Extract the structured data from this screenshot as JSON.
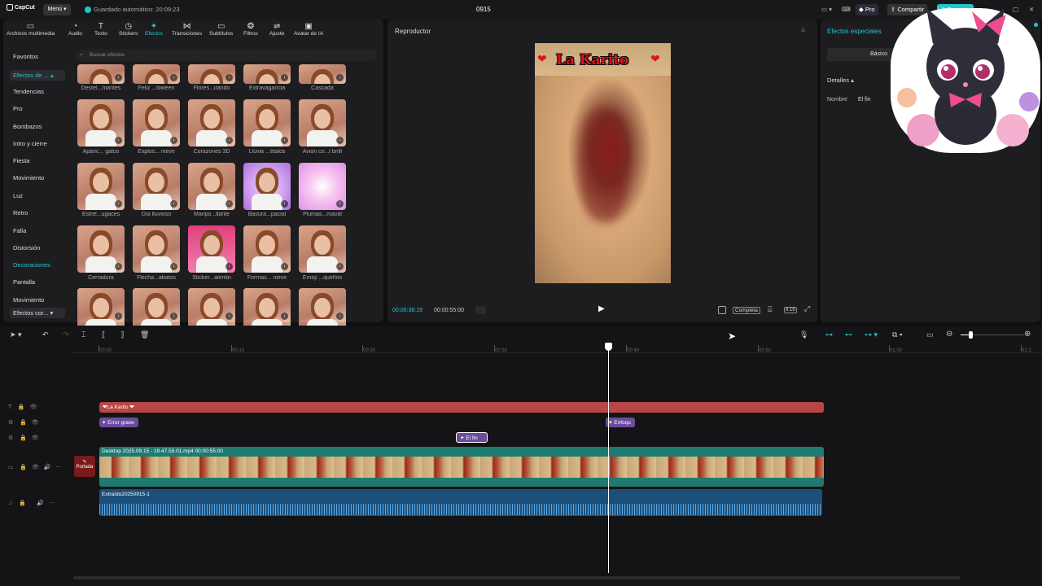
{
  "app": {
    "logo": "CapCut",
    "menu": "Menú",
    "autosave": "Guardado automático: 20:09:23",
    "project_title": "0915",
    "pro": "Pro",
    "share": "Compartir",
    "export": "Exportar"
  },
  "toolbar": [
    {
      "label": "Archivos multimedia",
      "icon": "▭"
    },
    {
      "label": "Audio",
      "icon": "◔"
    },
    {
      "label": "Texto",
      "icon": "T"
    },
    {
      "label": "Stickers",
      "icon": "◷"
    },
    {
      "label": "Efectos",
      "icon": "✦"
    },
    {
      "label": "Transiciones",
      "icon": "⋈"
    },
    {
      "label": "Subtítulos",
      "icon": "▭"
    },
    {
      "label": "Filtros",
      "icon": "❂"
    },
    {
      "label": "Ajuste",
      "icon": "⇌"
    },
    {
      "label": "Avatar de IA",
      "icon": "▣"
    }
  ],
  "categories": [
    "Favoritos",
    "Efectos de ...",
    "Tendencias",
    "Pro",
    "Bombazos",
    "Intro y cierre",
    "Fiesta",
    "Movimiento",
    "Luz",
    "Retro",
    "Falla",
    "Distorsión",
    "Decoraciones",
    "Pantalla",
    "Movimiento",
    "Efectos cor..."
  ],
  "search_placeholder": "Buscar efectos",
  "effects": [
    [
      "Destel...mantes",
      "Feliz ...loween",
      "Flores...irando",
      "Extravagancia",
      "Cascada"
    ],
    [
      "Aparic... gatos",
      "Explos... nieve",
      "Corazones 3D",
      "Lluvia ...étalos",
      "Avión co...l brilli"
    ],
    [
      "Estrel...ugaces",
      "Día lluvioso",
      "Maripo...llante",
      "Basura...pacial",
      "Plumas...maval"
    ],
    [
      "Cerradura",
      "Flecha...abatos",
      "Sticker...alentin",
      "Formas... nieve",
      "Emoji ...queños"
    ]
  ],
  "player": {
    "title": "Reproductor",
    "overlay_text": "La Karito",
    "time_current": "00:00:38:19",
    "time_total": "00:00:55:00",
    "view_mode": "Completa",
    "ratio": "9:16"
  },
  "props": {
    "title": "Efectos especiales",
    "tab_basic": "Básico",
    "details": "Detalles",
    "name_label": "Nombre",
    "name_value": "El fin"
  },
  "ruler": [
    "00:00",
    "00:10",
    "00:20",
    "00:30",
    "00:40",
    "00:50",
    "01:00",
    "01:1"
  ],
  "clips": {
    "text": "La Karito",
    "effect1": "Error grave",
    "effect2": "Enfoqu",
    "effect3": "El fin",
    "video": "Desktop 2025.09.15 - 19.47.59.01.mp4   00:00:55:00",
    "cover": "Portada",
    "audio": "Extraído20250915-1"
  },
  "colors": {
    "accent": "#22c5d0",
    "text_clip": "#b94646",
    "effect_clip": "#6a4c9c",
    "video_clip": "#1f7a72",
    "audio_clip": "#1b4f7a"
  }
}
